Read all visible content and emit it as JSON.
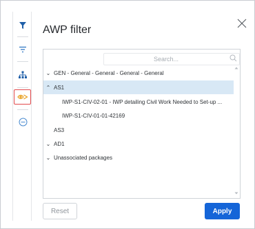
{
  "dialog": {
    "title": "AWP filter",
    "search_placeholder": "Search...",
    "reset_label": "Reset",
    "apply_label": "Apply"
  },
  "sidebar": {
    "icons": [
      "filter-icon",
      "list-filter-icon",
      "hierarchy-icon",
      "packages-eye-icon",
      "minus-circle-icon"
    ],
    "active_index": 3
  },
  "tree": {
    "items": [
      {
        "label": "GEN - General - General - General - General",
        "chevron": "down",
        "level": 0,
        "selected": false
      },
      {
        "label": "AS1",
        "chevron": "up",
        "level": 0,
        "selected": true
      },
      {
        "label": "IWP-S1-CIV-02-01 - IWP detailing Civil Work Needed to Set-up ...",
        "chevron": "",
        "level": 1,
        "selected": false
      },
      {
        "label": "IWP-S1-CIV-01-01-42169",
        "chevron": "",
        "level": 1,
        "selected": false
      },
      {
        "label": "AS3",
        "chevron": "",
        "level": 0,
        "selected": false
      },
      {
        "label": "AD1",
        "chevron": "down",
        "level": 0,
        "selected": false
      },
      {
        "label": "Unassociated packages",
        "chevron": "down",
        "level": 0,
        "selected": false
      }
    ]
  },
  "colors": {
    "accent": "#1565d8",
    "selected_row": "#d8e8f5",
    "active_outline": "#e2484b",
    "active_icon": "#e8a021"
  }
}
